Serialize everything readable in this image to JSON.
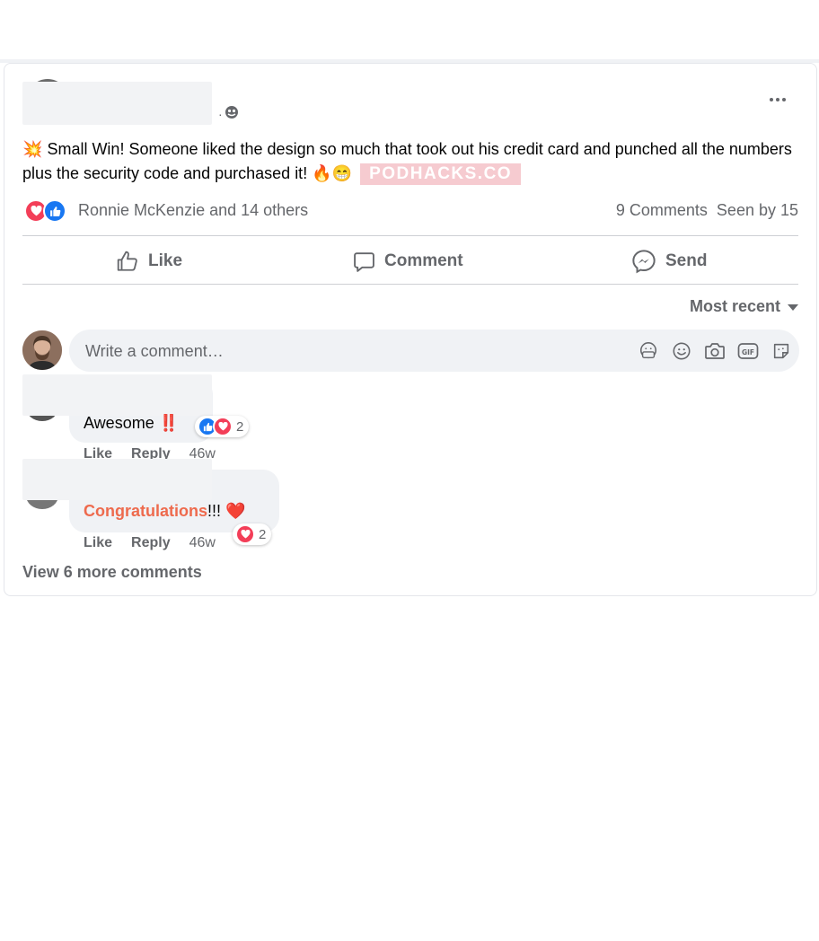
{
  "post": {
    "meta_separator": "·",
    "emoji_burst": "💥",
    "text": "Small Win! Someone liked the design so much that took out his credit card and punched all the numbers plus the security code and purchased it!",
    "emoji_fire": "🔥",
    "emoji_grin": "😁",
    "watermark": "PODHACKS.CO"
  },
  "reactions": {
    "names": "Ronnie McKenzie and 14 others",
    "comments_count": "9 Comments",
    "seen_by": "Seen by 15"
  },
  "actions": {
    "like": "Like",
    "comment": "Comment",
    "send": "Send"
  },
  "sort": {
    "label": "Most recent"
  },
  "composer": {
    "placeholder": "Write a comment…"
  },
  "comments": [
    {
      "text": "Awesome",
      "emoji": "‼️",
      "like": "Like",
      "reply": "Reply",
      "time": "46w",
      "reaction_count": "2"
    },
    {
      "text_highlight": "Congratulations",
      "text_rest": "!!!",
      "emoji": "❤️",
      "like": "Like",
      "reply": "Reply",
      "time": "46w",
      "reaction_count": "2"
    }
  ],
  "view_more": "View 6 more comments",
  "colors": {
    "like_blue": "#1877f2",
    "love_red": "#f33e58",
    "secondary_text": "#65676b",
    "highlight": "#ee6a4d"
  },
  "icons": [
    "more-options-icon",
    "globe-icon",
    "love-reaction-icon",
    "like-reaction-icon",
    "thumbs-up-icon",
    "comment-icon",
    "messenger-icon",
    "caret-down-icon",
    "sticker-avatar-icon",
    "emoji-icon",
    "camera-icon",
    "gif-icon",
    "sticker-icon"
  ]
}
